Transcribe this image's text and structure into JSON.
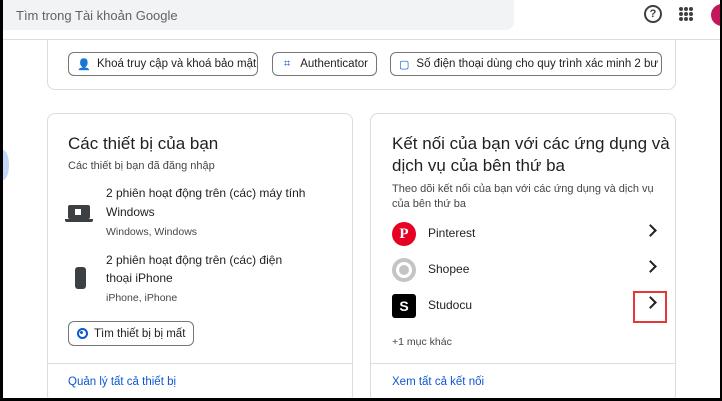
{
  "header": {
    "search_placeholder": "Tìm trong Tài khoản Google",
    "help_glyph": "?"
  },
  "security_chips": [
    {
      "label": "Khoá truy cập và khoá bảo mật",
      "icon": "person-key-icon"
    },
    {
      "label": "Authenticator",
      "icon": "qr-scan-icon"
    },
    {
      "label": "Số điện thoại dùng cho quy trình xác minh 2 bư",
      "icon": "message-icon"
    }
  ],
  "devices": {
    "title": "Các thiết bị của bạn",
    "subtitle": "Các thiết bị bạn đã đăng nhập",
    "items": [
      {
        "name_line1": "2 phiên hoạt động trên (các) máy tính",
        "name_line2": "Windows",
        "detail": "Windows, Windows",
        "icon": "laptop-icon"
      },
      {
        "name_line1": "2 phiên hoạt động trên (các) điện",
        "name_line2": "thoại iPhone",
        "detail": "iPhone, iPhone",
        "icon": "phone-icon"
      }
    ],
    "find_button": "Tìm thiết bị bị mất",
    "manage_link": "Quản lý tất cả thiết bị"
  },
  "connections": {
    "title_line1": "Kết nối của bạn với các ứng dụng và",
    "title_line2": "dịch vụ của bên thứ ba",
    "subtitle_line1": "Theo dõi kết nối của bạn với các ứng dụng và dịch vụ",
    "subtitle_line2": "của bên thứ ba",
    "apps": [
      {
        "name": "Pinterest",
        "logo_glyph": "P"
      },
      {
        "name": "Shopee",
        "logo_glyph": ""
      },
      {
        "name": "Studocu",
        "logo_glyph": "S"
      }
    ],
    "more_text": "+1 mục khác",
    "see_all_link": "Xem tất cả kết nối"
  },
  "colors": {
    "accent_blue": "#0b57d0",
    "pinterest_red": "#e60023",
    "highlight_red": "#e53935"
  }
}
